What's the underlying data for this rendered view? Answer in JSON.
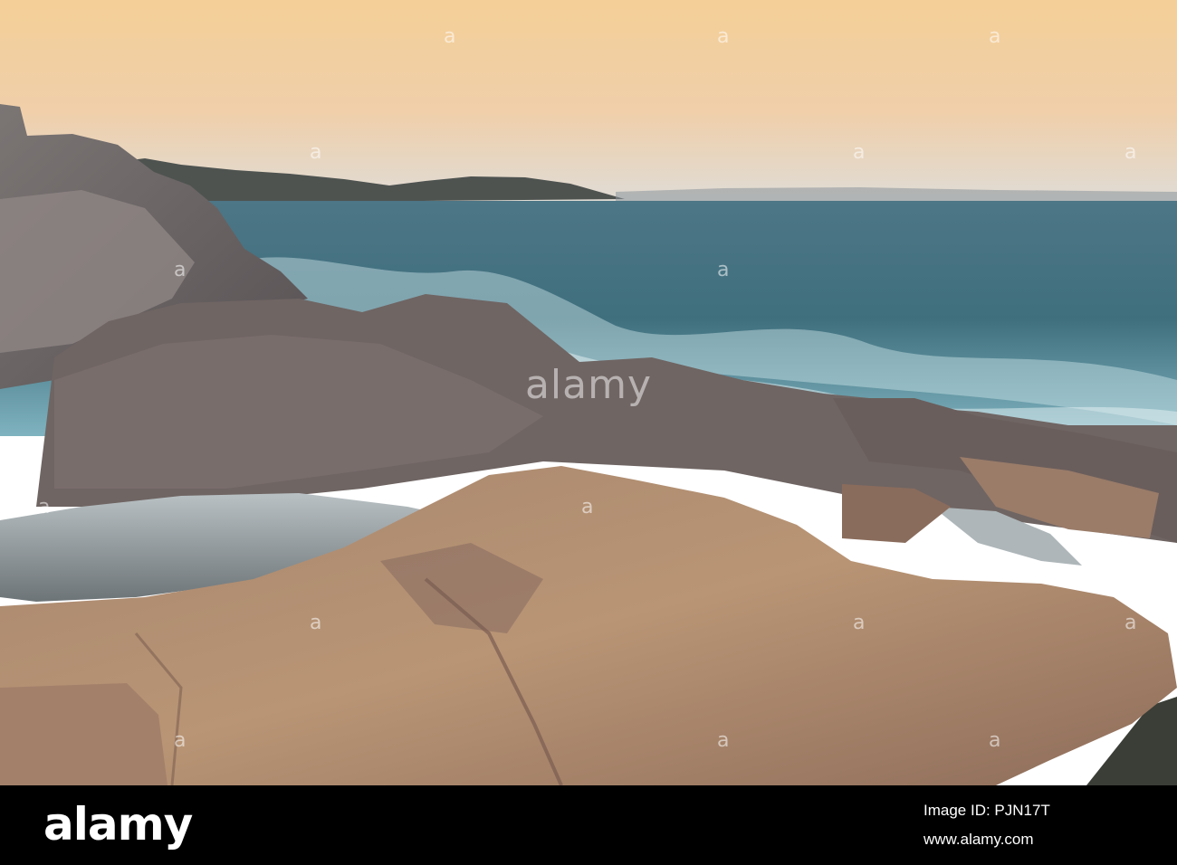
{
  "watermark": {
    "center_text": "alamy",
    "small_text": "a"
  },
  "footer": {
    "brand": "alamy",
    "image_id": "Image ID: PJN17T",
    "site": "www.alamy.com"
  },
  "scene": {
    "subject": "rocky seashore at dusk",
    "colors": {
      "sky_top": "#efc892",
      "sky_horizon": "#ecd8c0",
      "sea": "#3f6f7e",
      "rock_warm": "#b08a6a",
      "rock_grey": "#6f6a68"
    }
  }
}
